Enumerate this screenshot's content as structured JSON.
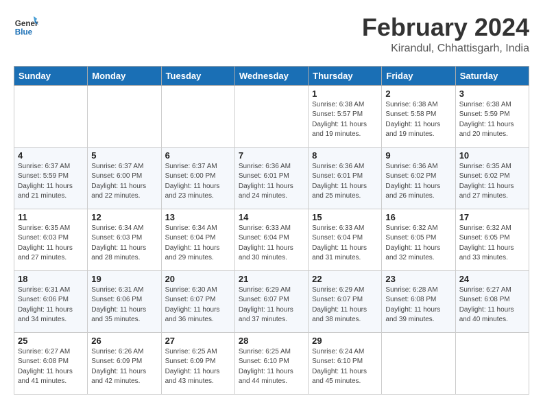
{
  "header": {
    "logo_line1": "General",
    "logo_line2": "Blue",
    "month": "February 2024",
    "location": "Kirandul, Chhattisgarh, India"
  },
  "weekdays": [
    "Sunday",
    "Monday",
    "Tuesday",
    "Wednesday",
    "Thursday",
    "Friday",
    "Saturday"
  ],
  "weeks": [
    [
      {
        "day": "",
        "sunrise": "",
        "sunset": "",
        "daylight": ""
      },
      {
        "day": "",
        "sunrise": "",
        "sunset": "",
        "daylight": ""
      },
      {
        "day": "",
        "sunrise": "",
        "sunset": "",
        "daylight": ""
      },
      {
        "day": "",
        "sunrise": "",
        "sunset": "",
        "daylight": ""
      },
      {
        "day": "1",
        "sunrise": "Sunrise: 6:38 AM",
        "sunset": "Sunset: 5:57 PM",
        "daylight": "Daylight: 11 hours and 19 minutes."
      },
      {
        "day": "2",
        "sunrise": "Sunrise: 6:38 AM",
        "sunset": "Sunset: 5:58 PM",
        "daylight": "Daylight: 11 hours and 19 minutes."
      },
      {
        "day": "3",
        "sunrise": "Sunrise: 6:38 AM",
        "sunset": "Sunset: 5:59 PM",
        "daylight": "Daylight: 11 hours and 20 minutes."
      }
    ],
    [
      {
        "day": "4",
        "sunrise": "Sunrise: 6:37 AM",
        "sunset": "Sunset: 5:59 PM",
        "daylight": "Daylight: 11 hours and 21 minutes."
      },
      {
        "day": "5",
        "sunrise": "Sunrise: 6:37 AM",
        "sunset": "Sunset: 6:00 PM",
        "daylight": "Daylight: 11 hours and 22 minutes."
      },
      {
        "day": "6",
        "sunrise": "Sunrise: 6:37 AM",
        "sunset": "Sunset: 6:00 PM",
        "daylight": "Daylight: 11 hours and 23 minutes."
      },
      {
        "day": "7",
        "sunrise": "Sunrise: 6:36 AM",
        "sunset": "Sunset: 6:01 PM",
        "daylight": "Daylight: 11 hours and 24 minutes."
      },
      {
        "day": "8",
        "sunrise": "Sunrise: 6:36 AM",
        "sunset": "Sunset: 6:01 PM",
        "daylight": "Daylight: 11 hours and 25 minutes."
      },
      {
        "day": "9",
        "sunrise": "Sunrise: 6:36 AM",
        "sunset": "Sunset: 6:02 PM",
        "daylight": "Daylight: 11 hours and 26 minutes."
      },
      {
        "day": "10",
        "sunrise": "Sunrise: 6:35 AM",
        "sunset": "Sunset: 6:02 PM",
        "daylight": "Daylight: 11 hours and 27 minutes."
      }
    ],
    [
      {
        "day": "11",
        "sunrise": "Sunrise: 6:35 AM",
        "sunset": "Sunset: 6:03 PM",
        "daylight": "Daylight: 11 hours and 27 minutes."
      },
      {
        "day": "12",
        "sunrise": "Sunrise: 6:34 AM",
        "sunset": "Sunset: 6:03 PM",
        "daylight": "Daylight: 11 hours and 28 minutes."
      },
      {
        "day": "13",
        "sunrise": "Sunrise: 6:34 AM",
        "sunset": "Sunset: 6:04 PM",
        "daylight": "Daylight: 11 hours and 29 minutes."
      },
      {
        "day": "14",
        "sunrise": "Sunrise: 6:33 AM",
        "sunset": "Sunset: 6:04 PM",
        "daylight": "Daylight: 11 hours and 30 minutes."
      },
      {
        "day": "15",
        "sunrise": "Sunrise: 6:33 AM",
        "sunset": "Sunset: 6:04 PM",
        "daylight": "Daylight: 11 hours and 31 minutes."
      },
      {
        "day": "16",
        "sunrise": "Sunrise: 6:32 AM",
        "sunset": "Sunset: 6:05 PM",
        "daylight": "Daylight: 11 hours and 32 minutes."
      },
      {
        "day": "17",
        "sunrise": "Sunrise: 6:32 AM",
        "sunset": "Sunset: 6:05 PM",
        "daylight": "Daylight: 11 hours and 33 minutes."
      }
    ],
    [
      {
        "day": "18",
        "sunrise": "Sunrise: 6:31 AM",
        "sunset": "Sunset: 6:06 PM",
        "daylight": "Daylight: 11 hours and 34 minutes."
      },
      {
        "day": "19",
        "sunrise": "Sunrise: 6:31 AM",
        "sunset": "Sunset: 6:06 PM",
        "daylight": "Daylight: 11 hours and 35 minutes."
      },
      {
        "day": "20",
        "sunrise": "Sunrise: 6:30 AM",
        "sunset": "Sunset: 6:07 PM",
        "daylight": "Daylight: 11 hours and 36 minutes."
      },
      {
        "day": "21",
        "sunrise": "Sunrise: 6:29 AM",
        "sunset": "Sunset: 6:07 PM",
        "daylight": "Daylight: 11 hours and 37 minutes."
      },
      {
        "day": "22",
        "sunrise": "Sunrise: 6:29 AM",
        "sunset": "Sunset: 6:07 PM",
        "daylight": "Daylight: 11 hours and 38 minutes."
      },
      {
        "day": "23",
        "sunrise": "Sunrise: 6:28 AM",
        "sunset": "Sunset: 6:08 PM",
        "daylight": "Daylight: 11 hours and 39 minutes."
      },
      {
        "day": "24",
        "sunrise": "Sunrise: 6:27 AM",
        "sunset": "Sunset: 6:08 PM",
        "daylight": "Daylight: 11 hours and 40 minutes."
      }
    ],
    [
      {
        "day": "25",
        "sunrise": "Sunrise: 6:27 AM",
        "sunset": "Sunset: 6:08 PM",
        "daylight": "Daylight: 11 hours and 41 minutes."
      },
      {
        "day": "26",
        "sunrise": "Sunrise: 6:26 AM",
        "sunset": "Sunset: 6:09 PM",
        "daylight": "Daylight: 11 hours and 42 minutes."
      },
      {
        "day": "27",
        "sunrise": "Sunrise: 6:25 AM",
        "sunset": "Sunset: 6:09 PM",
        "daylight": "Daylight: 11 hours and 43 minutes."
      },
      {
        "day": "28",
        "sunrise": "Sunrise: 6:25 AM",
        "sunset": "Sunset: 6:10 PM",
        "daylight": "Daylight: 11 hours and 44 minutes."
      },
      {
        "day": "29",
        "sunrise": "Sunrise: 6:24 AM",
        "sunset": "Sunset: 6:10 PM",
        "daylight": "Daylight: 11 hours and 45 minutes."
      },
      {
        "day": "",
        "sunrise": "",
        "sunset": "",
        "daylight": ""
      },
      {
        "day": "",
        "sunrise": "",
        "sunset": "",
        "daylight": ""
      }
    ]
  ]
}
